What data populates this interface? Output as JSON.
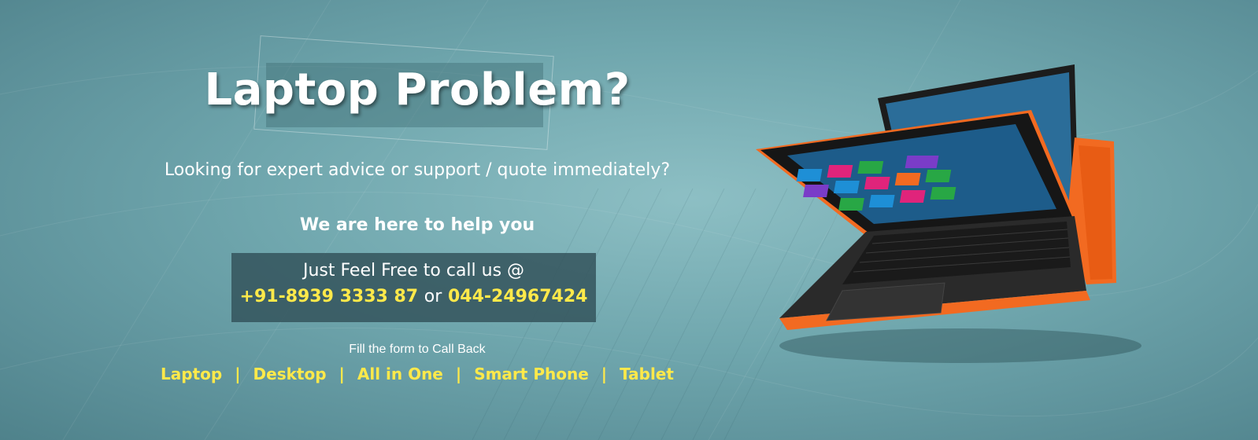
{
  "hero": {
    "title": "Laptop Problem?",
    "subtitle": "Looking for expert advice or support / quote immediately?",
    "help_text": "We are here to help you"
  },
  "call": {
    "line1": "Just Feel Free to call us @",
    "phone1": "+91-8939 3333 87",
    "or_text": "or",
    "phone2": "044-24967424"
  },
  "form_hint": "Fill the form to Call Back",
  "categories": [
    {
      "label": "Laptop"
    },
    {
      "label": "Desktop"
    },
    {
      "label": "All in One"
    },
    {
      "label": "Smart Phone"
    },
    {
      "label": "Tablet"
    }
  ],
  "separator": "|",
  "colors": {
    "accent_yellow": "#ffe94a",
    "background_teal": "#6fa6ad",
    "call_box": "#34545c",
    "laptop_orange": "#f26a21"
  },
  "image": {
    "description_icon": "laptop-icon"
  }
}
